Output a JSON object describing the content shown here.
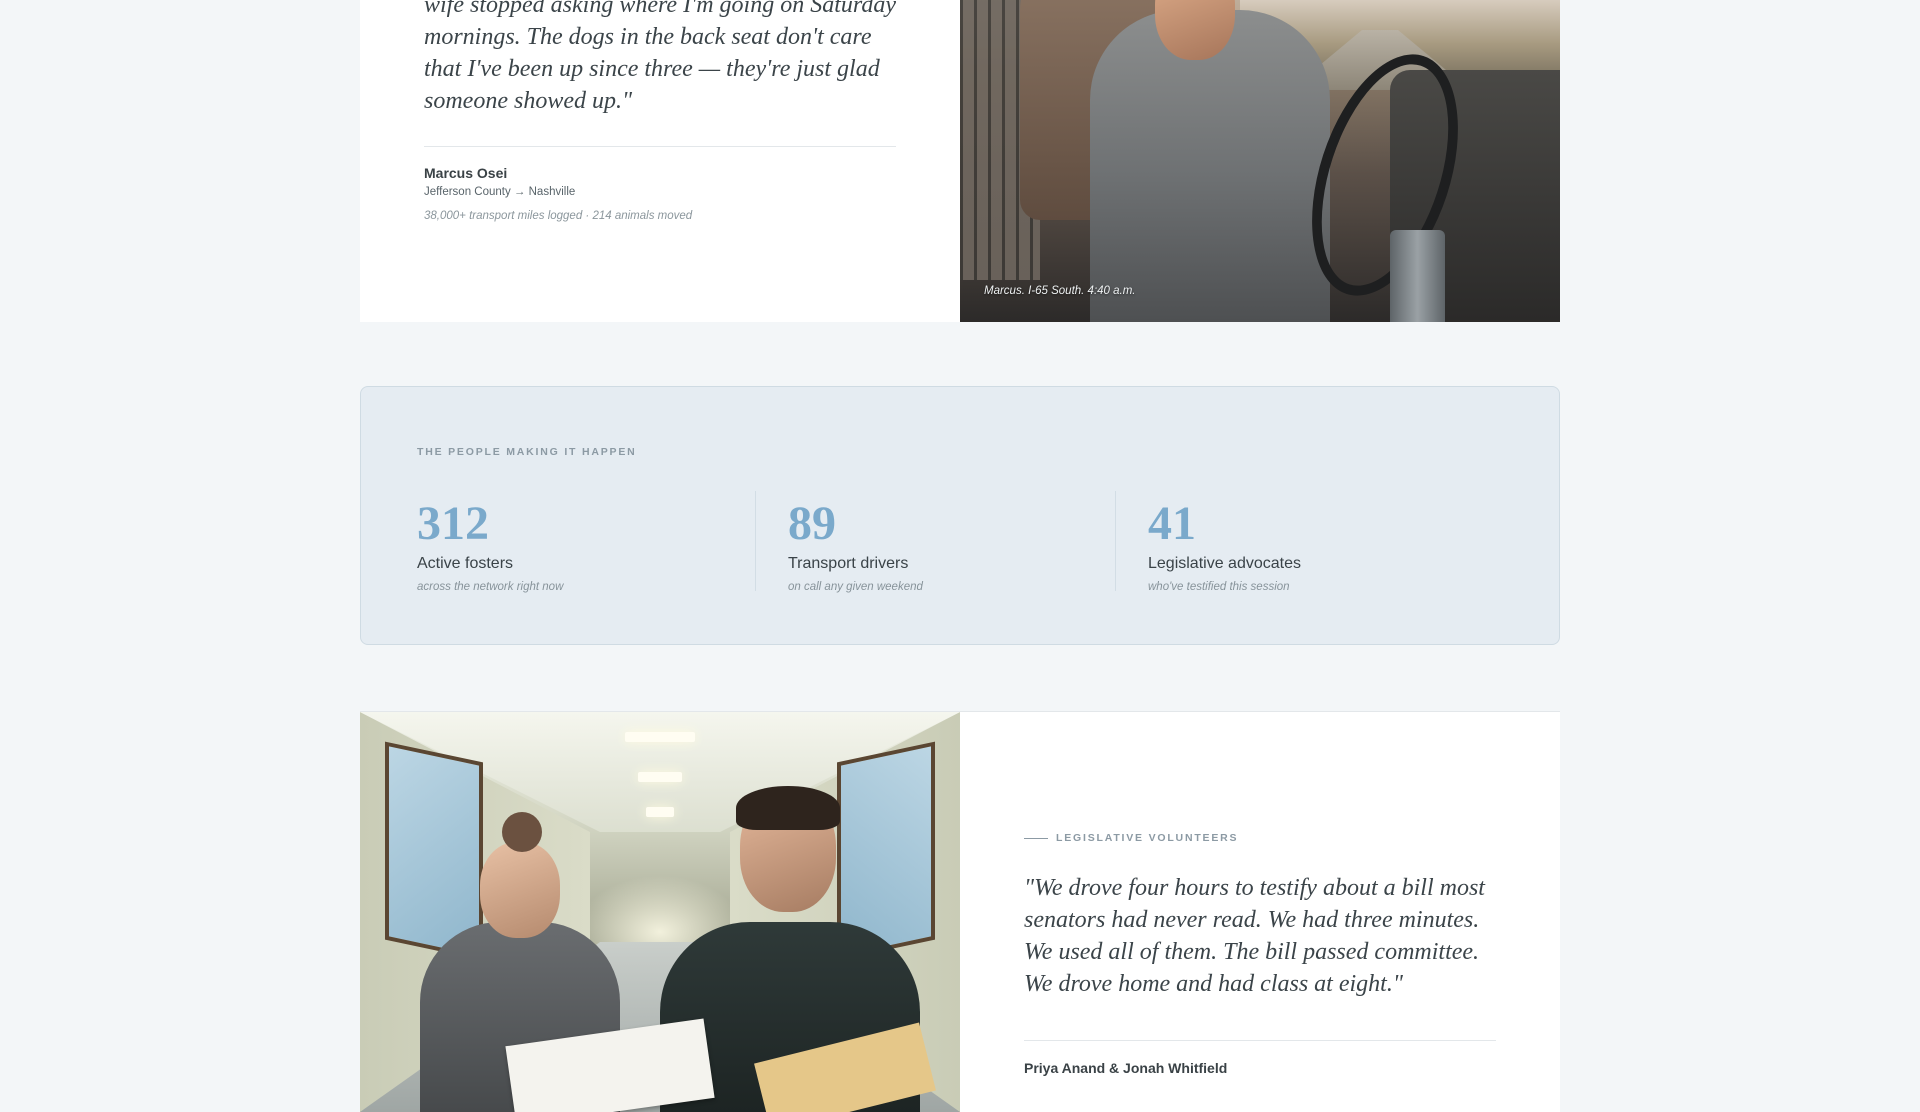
{
  "story_marcus": {
    "quote": "wife stopped asking where I'm going on Saturday mornings. The dogs in the back seat don't care that I've been up since three — they're just glad someone showed up.\"",
    "name": "Marcus Osei",
    "route": "Jefferson County → Nashville",
    "stats": "38,000+ transport miles logged · 214 animals moved",
    "photo_caption": "Marcus. I-65 South. 4:40 a.m."
  },
  "people_stats": {
    "eyebrow": "THE PEOPLE MAKING IT HAPPEN",
    "items": [
      {
        "number": "312",
        "label": "Active fosters",
        "sub": "across the network right now"
      },
      {
        "number": "89",
        "label": "Transport drivers",
        "sub": "on call any given weekend"
      },
      {
        "number": "41",
        "label": "Legislative advocates",
        "sub": "who've testified this session"
      }
    ]
  },
  "story_legislative": {
    "eyebrow": "LEGISLATIVE VOLUNTEERS",
    "quote": "\"We drove four hours to testify about a bill most senators had never read. We had three minutes. We used all of them. The bill passed committee. We drove home and had class at eight.\"",
    "name": "Priya Anand & Jonah Whitfield"
  },
  "colors": {
    "page_background": "#f3f6f8",
    "stat_number": "#7aa9cb",
    "stats_panel": "#e5ecf2"
  }
}
